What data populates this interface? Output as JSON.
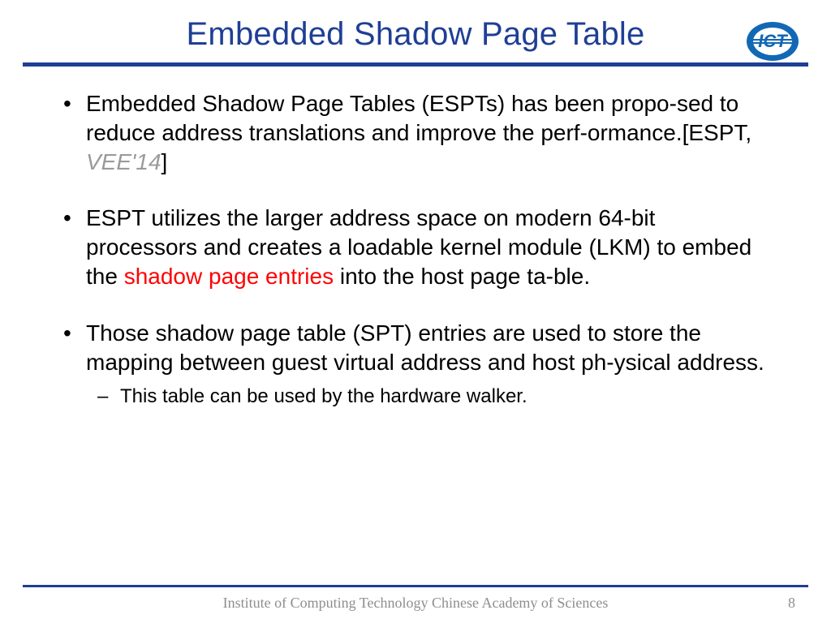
{
  "title": "Embedded Shadow Page Table",
  "logo_text": "ICT",
  "bullets": {
    "b1_a": "Embedded Shadow Page Tables (ESPTs) has been propo-sed to reduce address translations and improve the perf-ormance.[ESPT, ",
    "b1_cite": "VEE'14",
    "b1_b": "]",
    "b2_a": "ESPT utilizes the larger address space on modern 64-bit processors and creates a loadable kernel module (LKM) to embed the ",
    "b2_red": "shadow page entries",
    "b2_b": " into the host page ta-ble.",
    "b3": "Those shadow page table (SPT) entries are used to store the mapping between guest virtual address and host ph-ysical address.",
    "b3_sub": "This table can be used by the hardware walker."
  },
  "footer": "Institute of Computing Technology Chinese Academy of Sciences",
  "page_num": "8"
}
